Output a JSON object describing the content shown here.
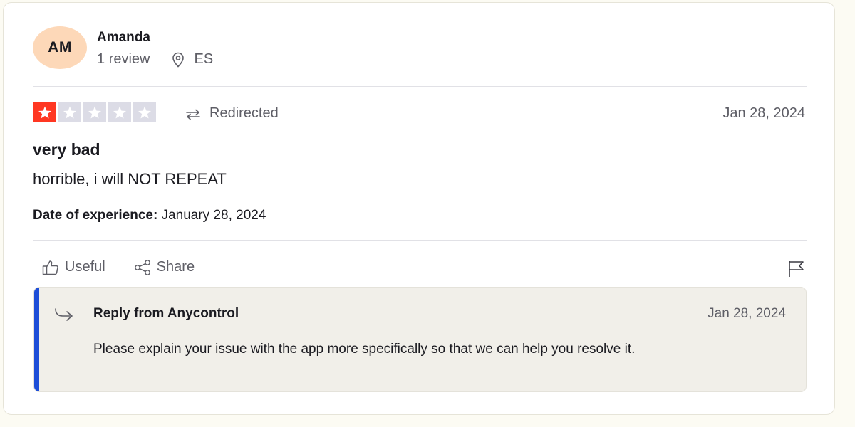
{
  "reviewer": {
    "initials": "AM",
    "name": "Amanda",
    "review_count": "1 review",
    "country": "ES"
  },
  "review": {
    "rating": 1,
    "rating_max": 5,
    "redirected_label": "Redirected",
    "date": "Jan 28, 2024",
    "title": "very bad",
    "body": "horrible, i will NOT REPEAT",
    "experience_label": "Date of experience:",
    "experience_date": "January 28, 2024"
  },
  "actions": {
    "useful_label": "Useful",
    "share_label": "Share"
  },
  "reply": {
    "title": "Reply from Anycontrol",
    "date": "Jan 28, 2024",
    "body": "Please explain your issue with the app more specifically so that we can help you resolve it."
  },
  "colors": {
    "star_filled": "#ff3722",
    "star_empty": "#dcdce6",
    "avatar_bg": "#fdd8b8",
    "reply_accent": "#1d4ed8",
    "reply_bg": "#f1efe9"
  },
  "icons": {
    "location": "location-pin-icon",
    "redirected": "redirect-arrow-icon",
    "useful": "thumbs-up-icon",
    "share": "share-icon",
    "flag": "flag-icon",
    "reply": "reply-arrow-icon",
    "star": "star-icon"
  }
}
